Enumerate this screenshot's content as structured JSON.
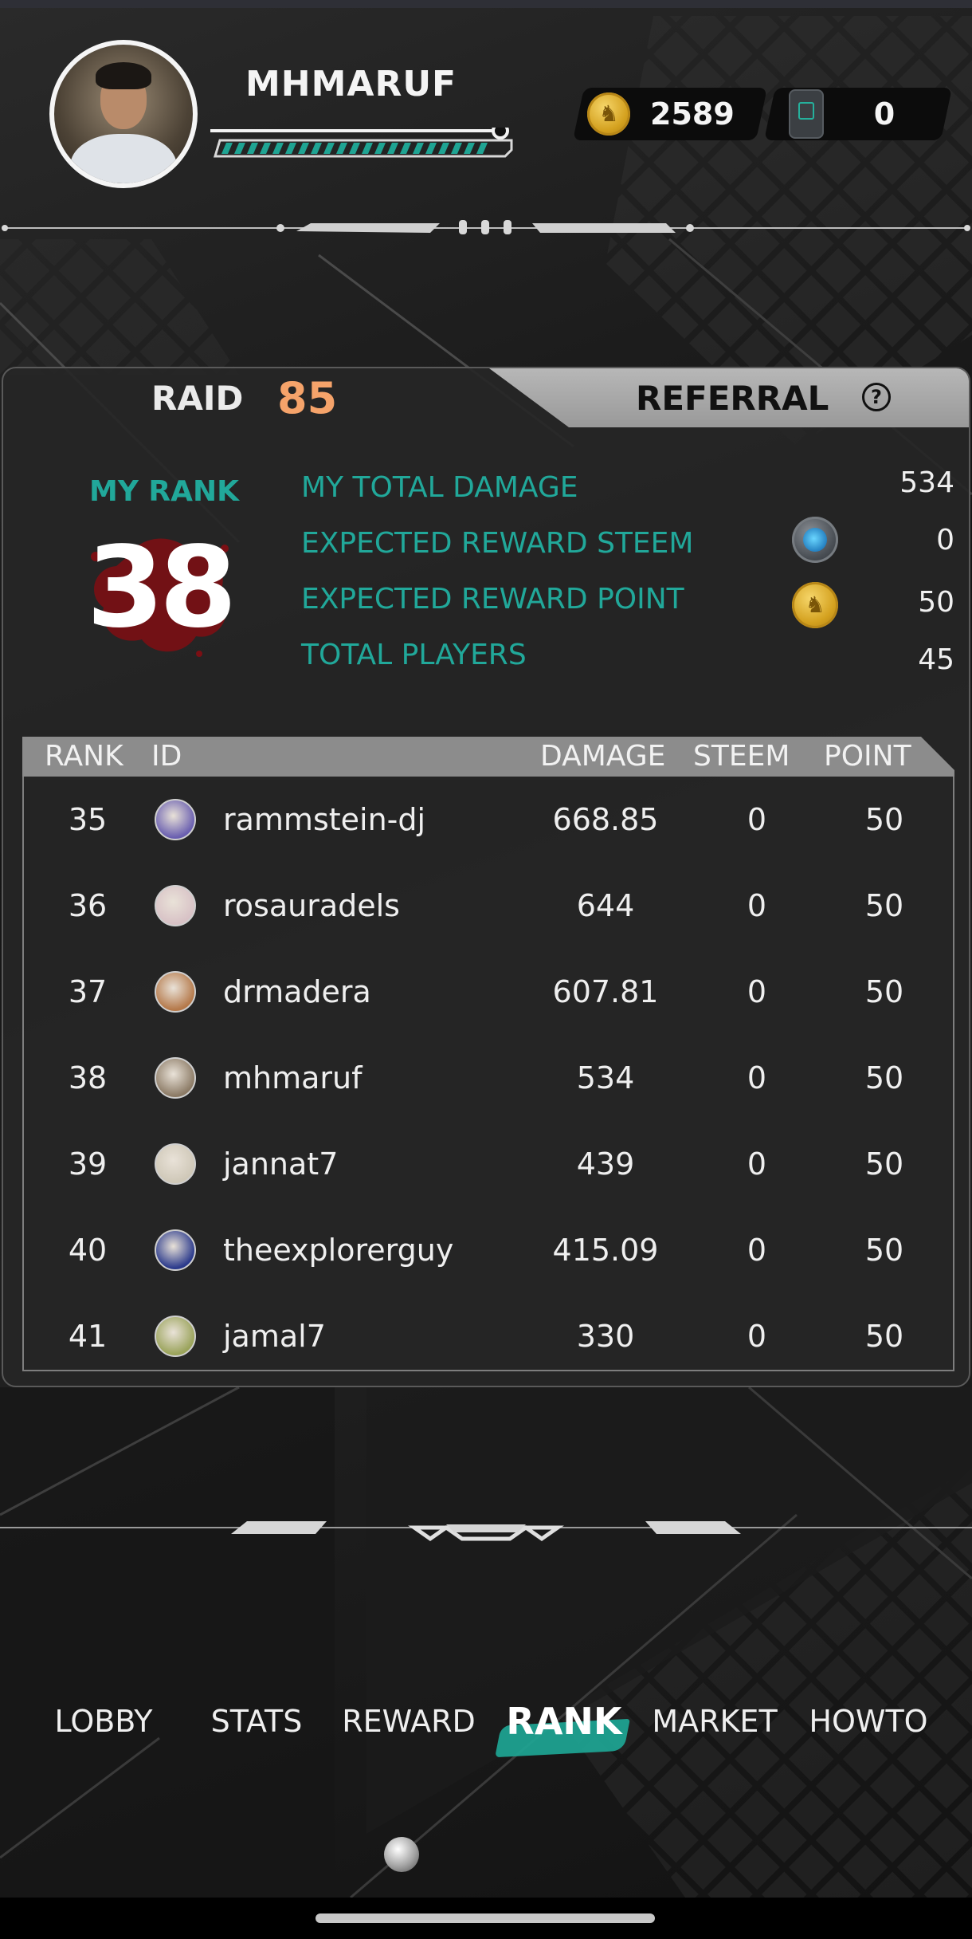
{
  "header": {
    "username": "MHMARUF",
    "xp_level": 0.92,
    "coins": "2589",
    "tickets": "0"
  },
  "panel": {
    "tabs": {
      "raid_label": "RAID",
      "raid_count": "85",
      "referral_label": "REFERRAL",
      "help_glyph": "?"
    },
    "my_rank": {
      "label": "MY RANK",
      "value": "38"
    },
    "stats": [
      {
        "label": "MY TOTAL DAMAGE",
        "value": "534"
      },
      {
        "label": "EXPECTED REWARD STEEM",
        "value": "0",
        "icon": "steem-icon"
      },
      {
        "label": "EXPECTED REWARD POINT",
        "value": "50",
        "icon": "point-coin-icon"
      },
      {
        "label": "TOTAL PLAYERS",
        "value": "45"
      }
    ],
    "table": {
      "columns": [
        "RANK",
        "ID",
        "DAMAGE",
        "STEEM",
        "POINT"
      ],
      "rows": [
        {
          "rank": "35",
          "id": "rammstein-dj",
          "damage": "668.85",
          "steem": "0",
          "point": "50",
          "avatar_color": "#6a5fb0"
        },
        {
          "rank": "36",
          "id": "rosauradels",
          "damage": "644",
          "steem": "0",
          "point": "50",
          "avatar_color": "#d8c2c6"
        },
        {
          "rank": "37",
          "id": "drmadera",
          "damage": "607.81",
          "steem": "0",
          "point": "50",
          "avatar_color": "#b5794a"
        },
        {
          "rank": "38",
          "id": "mhmaruf",
          "damage": "534",
          "steem": "0",
          "point": "50",
          "avatar_color": "#8c7b66"
        },
        {
          "rank": "39",
          "id": "jannat7",
          "damage": "439",
          "steem": "0",
          "point": "50",
          "avatar_color": "#cfc8b8"
        },
        {
          "rank": "40",
          "id": "theexplorerguy",
          "damage": "415.09",
          "steem": "0",
          "point": "50",
          "avatar_color": "#2b3a8c"
        },
        {
          "rank": "41",
          "id": "jamal7",
          "damage": "330",
          "steem": "0",
          "point": "50",
          "avatar_color": "#9aa35a"
        }
      ]
    }
  },
  "nav": {
    "items": [
      "LOBBY",
      "STATS",
      "REWARD",
      "RANK",
      "MARKET",
      "HOWTO"
    ],
    "active": "RANK"
  },
  "colors": {
    "accent_teal": "#21a89a",
    "raid_orange": "#f5a36a",
    "coin_gold": "#d4a11f"
  }
}
